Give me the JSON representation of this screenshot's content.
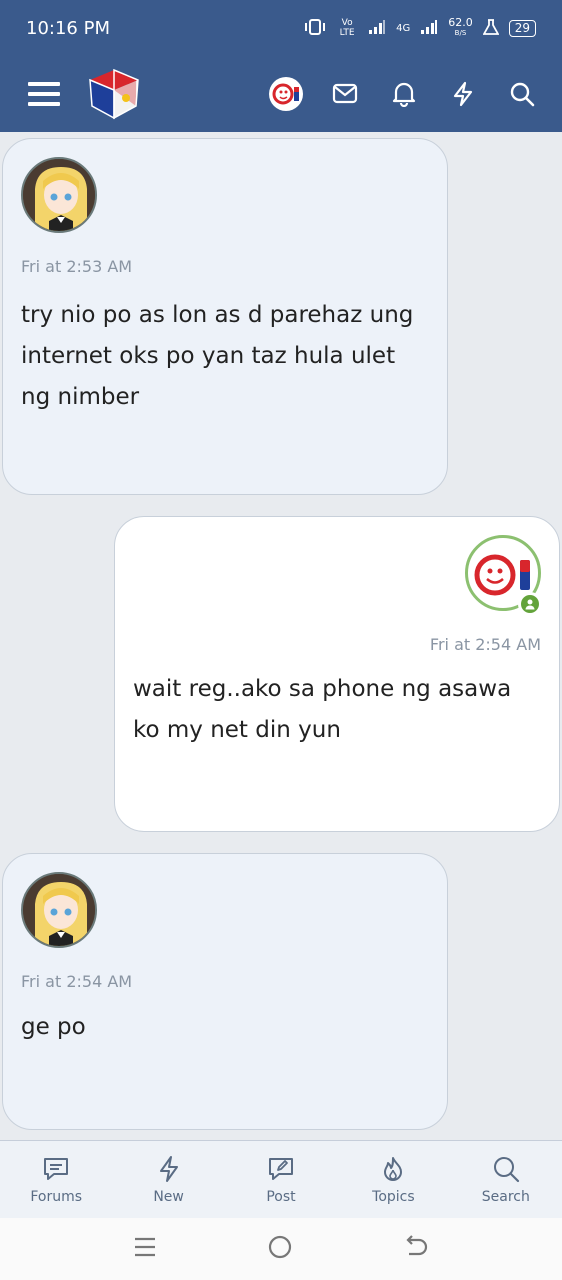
{
  "status_bar": {
    "time": "10:16 PM",
    "net_speed": "62.0",
    "net_unit": "B/S",
    "battery": "29",
    "volte": "Vo LTE",
    "net_type": "4G"
  },
  "messages": [
    {
      "direction": "incoming",
      "time": "Fri at 2:53 AM",
      "text": "try nio po as lon as d parehaz ung internet oks po yan taz hula ulet ng nimber"
    },
    {
      "direction": "outgoing",
      "time": "Fri at 2:54 AM",
      "text": "wait reg..ako sa phone ng asawa ko my net din yun"
    },
    {
      "direction": "incoming",
      "time": "Fri at 2:54 AM",
      "text": "ge po"
    }
  ],
  "tabbar": {
    "items": [
      {
        "label": "Forums",
        "icon": "forums-icon"
      },
      {
        "label": "New",
        "icon": "lightning-icon"
      },
      {
        "label": "Post",
        "icon": "post-icon"
      },
      {
        "label": "Topics",
        "icon": "flame-icon"
      },
      {
        "label": "Search",
        "icon": "search-icon"
      }
    ]
  },
  "colors": {
    "header": "#3a5a8c",
    "incoming_bubble": "#edf2f9",
    "outgoing_bubble": "#ffffff",
    "online": "#63a33b"
  }
}
